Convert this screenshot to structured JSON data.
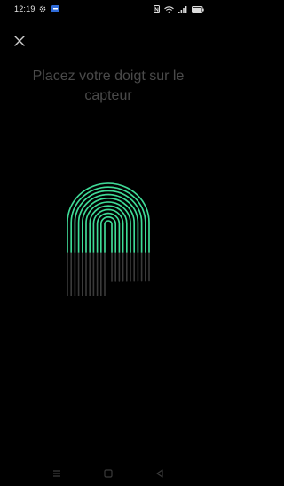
{
  "status_bar": {
    "time": "12:19",
    "left_icons": [
      "gear-icon",
      "app-notification-icon"
    ],
    "right_icons": [
      "nfc-icon",
      "wifi-icon",
      "signal-icon",
      "battery-icon"
    ]
  },
  "header": {
    "close_icon": "close-icon"
  },
  "main": {
    "title": "Placez votre doigt sur le capteur"
  },
  "fingerprint": {
    "progress_fraction": 0.6,
    "active_color": "#3ddc97",
    "inactive_color": "#3a3a3a"
  },
  "nav_bar": {
    "buttons": [
      "menu-icon",
      "home-icon",
      "back-icon"
    ]
  },
  "colors": {
    "background": "#000000",
    "title_text": "#4a4a4a"
  }
}
